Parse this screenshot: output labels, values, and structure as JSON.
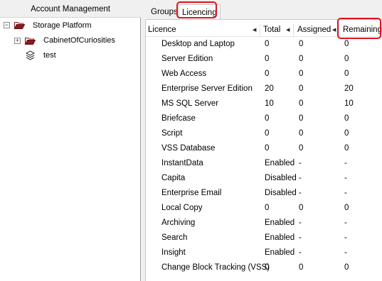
{
  "tree": {
    "header": "Account Management",
    "root": {
      "label": "Storage Platform",
      "expander": "−"
    },
    "children": [
      {
        "label": "CabinetOfCuriosities",
        "expander": "+",
        "icon": "folder-icon"
      },
      {
        "label": "test",
        "icon": "layers-icon"
      }
    ]
  },
  "tabs": [
    {
      "label": "Groups",
      "active": false
    },
    {
      "label": "Licencing",
      "active": true
    }
  ],
  "table": {
    "columns": [
      {
        "label": "Licence"
      },
      {
        "label": "Total"
      },
      {
        "label": "Assigned"
      },
      {
        "label": "Remaining"
      }
    ],
    "rows": [
      {
        "name": "Desktop and Laptop",
        "total": "0",
        "assigned": "0",
        "remaining": "0"
      },
      {
        "name": "Server Edition",
        "total": "0",
        "assigned": "0",
        "remaining": "0"
      },
      {
        "name": "Web Access",
        "total": "0",
        "assigned": "0",
        "remaining": "0"
      },
      {
        "name": "Enterprise Server Edition",
        "total": "20",
        "assigned": "0",
        "remaining": "20"
      },
      {
        "name": "MS SQL Server",
        "total": "10",
        "assigned": "0",
        "remaining": "10"
      },
      {
        "name": "Briefcase",
        "total": "0",
        "assigned": "0",
        "remaining": "0"
      },
      {
        "name": "Script",
        "total": "0",
        "assigned": "0",
        "remaining": "0"
      },
      {
        "name": "VSS Database",
        "total": "0",
        "assigned": "0",
        "remaining": "0"
      },
      {
        "name": "InstantData",
        "total": "Enabled",
        "assigned": "-",
        "remaining": "-"
      },
      {
        "name": "Capita",
        "total": "Disabled",
        "assigned": "-",
        "remaining": "-"
      },
      {
        "name": "Enterprise  Email",
        "total": "Disabled",
        "assigned": "-",
        "remaining": "-"
      },
      {
        "name": "Local Copy",
        "total": "0",
        "assigned": "0",
        "remaining": "0"
      },
      {
        "name": "Archiving",
        "total": "Enabled",
        "assigned": "-",
        "remaining": "-"
      },
      {
        "name": "Search",
        "total": "Enabled",
        "assigned": "-",
        "remaining": "-"
      },
      {
        "name": "Insight",
        "total": "Enabled",
        "assigned": "-",
        "remaining": "-"
      },
      {
        "name": "Change Block Tracking (VSS)",
        "total": "0",
        "assigned": "0",
        "remaining": "0"
      }
    ]
  },
  "colors": {
    "highlight": "#e0141e",
    "folder": "#8b1a1a",
    "panel_bg": "#f0f0f0"
  }
}
